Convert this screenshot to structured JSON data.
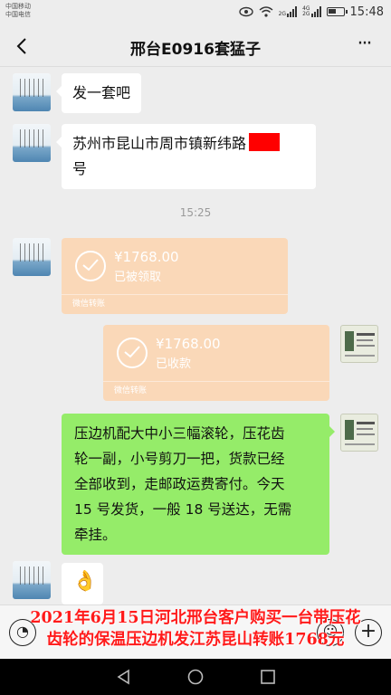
{
  "status_bar": {
    "carrier_1": "中国移动",
    "carrier_2": "中国电信",
    "net_1": "2G",
    "net_2_top": "4G",
    "net_2_bottom": "2G",
    "time": "15:48",
    "battery_level": 0.55
  },
  "header": {
    "title": "邢台E0916套猛子",
    "back_icon": "back-chevron-icon",
    "more_icon": "more-dots-icon"
  },
  "messages": [
    {
      "side": "left",
      "type": "text",
      "text": "发一套吧"
    },
    {
      "side": "left",
      "type": "text",
      "line1": "苏州市昆山市周市镇新纬路",
      "line2": "号",
      "redacted": true
    },
    {
      "type": "time",
      "text": "15:25"
    },
    {
      "side": "left",
      "type": "transfer",
      "amount": "¥1768.00",
      "status": "已被领取",
      "footer": "微信转账"
    },
    {
      "side": "right",
      "type": "transfer",
      "amount": "¥1768.00",
      "status": "已收款",
      "footer": "微信转账"
    },
    {
      "side": "right",
      "type": "text",
      "lines": [
        "压边机配大中小三幅滚轮，压花齿",
        "轮一副，小号剪刀一把，货款已经",
        "全部收到，走邮政运费寄付。今天",
        "15 号发货，一般 18 号送达，无需",
        "牵挂。"
      ]
    },
    {
      "side": "left",
      "type": "emoji",
      "emoji": "👌"
    }
  ],
  "caption": {
    "line1": "2021年6月15日河北邢台客户购买一台带压花",
    "line2": "齿轮的保温压边机发江苏昆山转账1768元",
    "color": "#ff1a1a"
  },
  "colors": {
    "background": "#ededed",
    "green_bubble": "#95ec69",
    "transfer_card": "#fad8b8"
  }
}
